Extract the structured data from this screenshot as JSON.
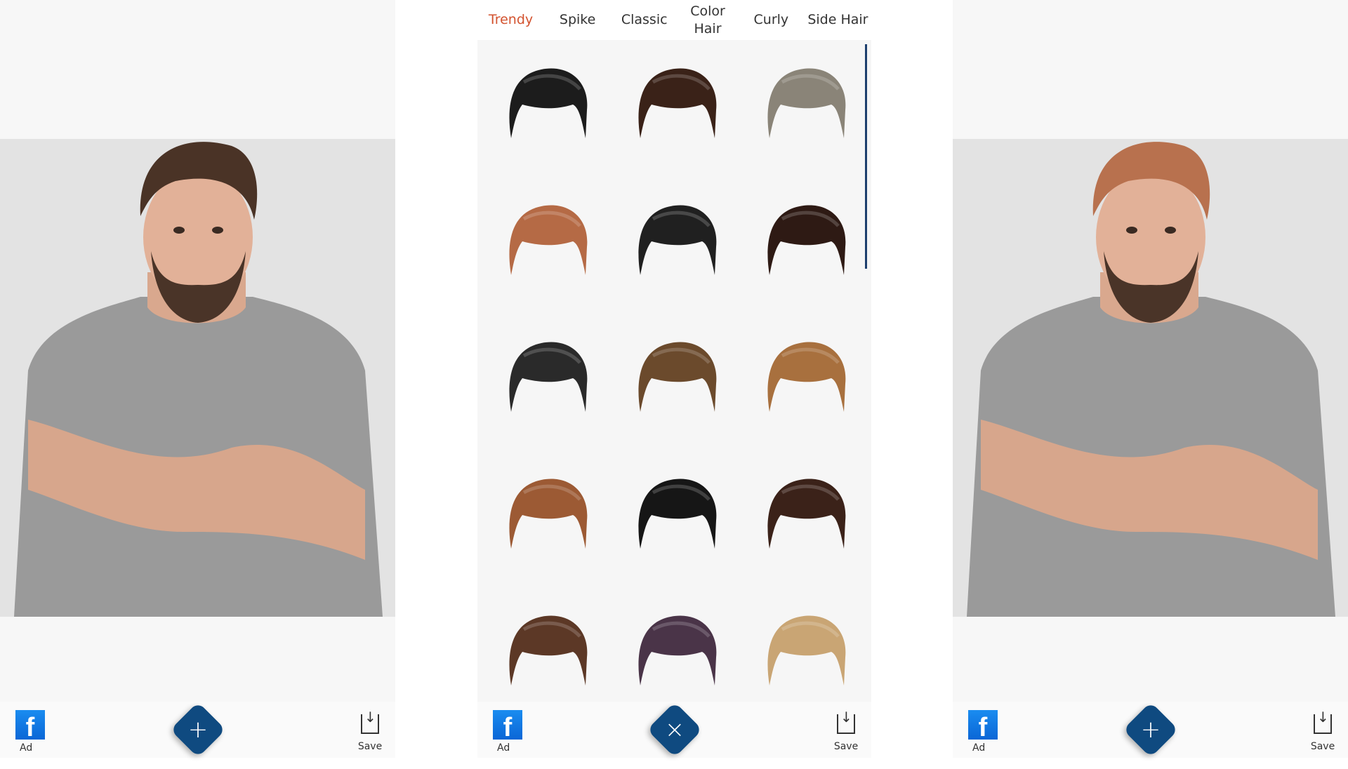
{
  "tabs": [
    {
      "label": "Trendy",
      "active": true
    },
    {
      "label": "Spike"
    },
    {
      "label": "Classic"
    },
    {
      "label": "Color Hair"
    },
    {
      "label": "Curly"
    },
    {
      "label": "Side Hair"
    }
  ],
  "hairstyles": [
    "#1c1c1c",
    "#3a2218",
    "#8a8478",
    "#b56a45",
    "#202020",
    "#2e1a14",
    "#2a2a2a",
    "#6b4a2c",
    "#a8703e",
    "#9c5a34",
    "#161616",
    "#3b2219",
    "#5c3826",
    "#4a3448",
    "#c9a574"
  ],
  "left": {
    "hair_color": "#4a3326",
    "ad_label": "Ad",
    "save_label": "Save",
    "fab_icon": "plus-icon"
  },
  "middle": {
    "ad_label": "Ad",
    "save_label": "Save",
    "fab_icon": "close-icon"
  },
  "right": {
    "hair_color": "#b8714e",
    "ad_label": "Ad",
    "save_label": "Save",
    "fab_icon": "plus-icon"
  },
  "colors": {
    "accent": "#d3532f",
    "fab": "#0f4a80",
    "facebook": "#1877f2"
  }
}
